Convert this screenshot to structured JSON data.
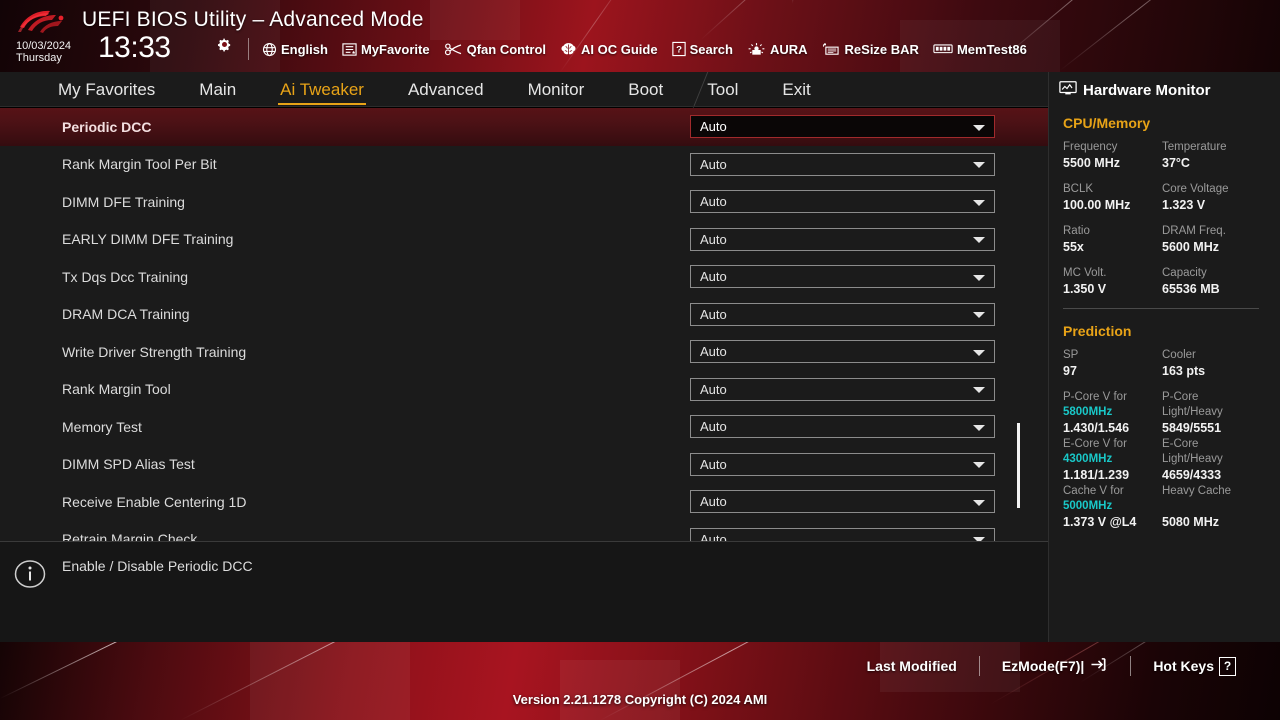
{
  "header": {
    "title": "UEFI BIOS Utility – Advanced Mode",
    "logo_icon": "rog-logo-icon",
    "date": "10/03/2024",
    "weekday": "Thursday",
    "time": "13:33",
    "gear_icon": "gear-icon",
    "tools": [
      {
        "label": "English",
        "icon": "globe-icon"
      },
      {
        "label": "MyFavorite",
        "icon": "star-list-icon"
      },
      {
        "label": "Qfan Control",
        "icon": "fan-icon"
      },
      {
        "label": "AI OC Guide",
        "icon": "brain-icon"
      },
      {
        "label": "Search",
        "icon": "question-box-icon"
      },
      {
        "label": "AURA",
        "icon": "aura-light-icon"
      },
      {
        "label": "ReSize BAR",
        "icon": "resize-bar-icon"
      },
      {
        "label": "MemTest86",
        "icon": "memory-module-icon"
      }
    ]
  },
  "nav": {
    "active": "Ai Tweaker",
    "tabs": [
      {
        "label": "My Favorites"
      },
      {
        "label": "Main"
      },
      {
        "label": "Ai Tweaker"
      },
      {
        "label": "Advanced"
      },
      {
        "label": "Monitor"
      },
      {
        "label": "Boot"
      },
      {
        "label": "Tool"
      },
      {
        "label": "Exit"
      }
    ]
  },
  "settings": {
    "selected_index": 0,
    "rows": [
      {
        "label": "Periodic DCC",
        "value": "Auto"
      },
      {
        "label": "Rank Margin Tool Per Bit",
        "value": "Auto"
      },
      {
        "label": "DIMM DFE Training",
        "value": "Auto"
      },
      {
        "label": "EARLY DIMM DFE Training",
        "value": "Auto"
      },
      {
        "label": "Tx Dqs Dcc Training",
        "value": "Auto"
      },
      {
        "label": "DRAM DCA Training",
        "value": "Auto"
      },
      {
        "label": "Write Driver Strength Training",
        "value": "Auto"
      },
      {
        "label": "Rank Margin Tool",
        "value": "Auto"
      },
      {
        "label": "Memory Test",
        "value": "Auto"
      },
      {
        "label": "DIMM SPD Alias Test",
        "value": "Auto"
      },
      {
        "label": "Receive Enable Centering 1D",
        "value": "Auto"
      },
      {
        "label": "Retrain Margin Check",
        "value": "Auto"
      }
    ]
  },
  "help": {
    "icon": "info-icon",
    "text": "Enable / Disable Periodic DCC"
  },
  "hardware_monitor": {
    "icon": "monitor-icon",
    "title": "Hardware Monitor",
    "sections": [
      {
        "name": "CPU/Memory",
        "pairs": [
          [
            {
              "key": "Frequency",
              "value": "5500 MHz"
            },
            {
              "key": "Temperature",
              "value": "37°C"
            }
          ],
          [
            {
              "key": "BCLK",
              "value": "100.00 MHz"
            },
            {
              "key": "Core Voltage",
              "value": "1.323 V"
            }
          ],
          [
            {
              "key": "Ratio",
              "value": "55x"
            },
            {
              "key": "DRAM Freq.",
              "value": "5600 MHz"
            }
          ],
          [
            {
              "key": "MC Volt.",
              "value": "1.350 V"
            },
            {
              "key": "Capacity",
              "value": "65536 MB"
            }
          ]
        ]
      },
      {
        "name": "Prediction",
        "pairs": [
          [
            {
              "key": "SP",
              "value": "97"
            },
            {
              "key": "Cooler",
              "value": "163 pts"
            }
          ]
        ],
        "tight_pairs": [
          [
            {
              "key": "P-Core V for",
              "key2": "5800MHz",
              "value": "1.430/1.546"
            },
            {
              "key": "P-Core",
              "key2": "Light/Heavy",
              "value": "5849/5551"
            }
          ],
          [
            {
              "key": "E-Core V for",
              "key2": "4300MHz",
              "value": "1.181/1.239"
            },
            {
              "key": "E-Core",
              "key2": "Light/Heavy",
              "value": "4659/4333"
            }
          ],
          [
            {
              "key": "Cache V for",
              "key2": "5000MHz",
              "value": "1.373 V @L4"
            },
            {
              "key": "Heavy Cache",
              "key2": "",
              "value": "5080 MHz"
            }
          ]
        ]
      }
    ]
  },
  "footer": {
    "links": [
      {
        "label": "Last Modified",
        "icon": ""
      },
      {
        "label": "EzMode(F7)|",
        "icon": "arrow-into-box-icon"
      },
      {
        "label": "Hot Keys",
        "icon": "question-box-icon"
      }
    ],
    "version": "Version 2.21.1278 Copyright (C) 2024 AMI"
  },
  "colors": {
    "accent_gold": "#e8a317",
    "accent_cyan": "#19c8c8",
    "selection_red": "#571317",
    "brand_red": "#a81420"
  }
}
